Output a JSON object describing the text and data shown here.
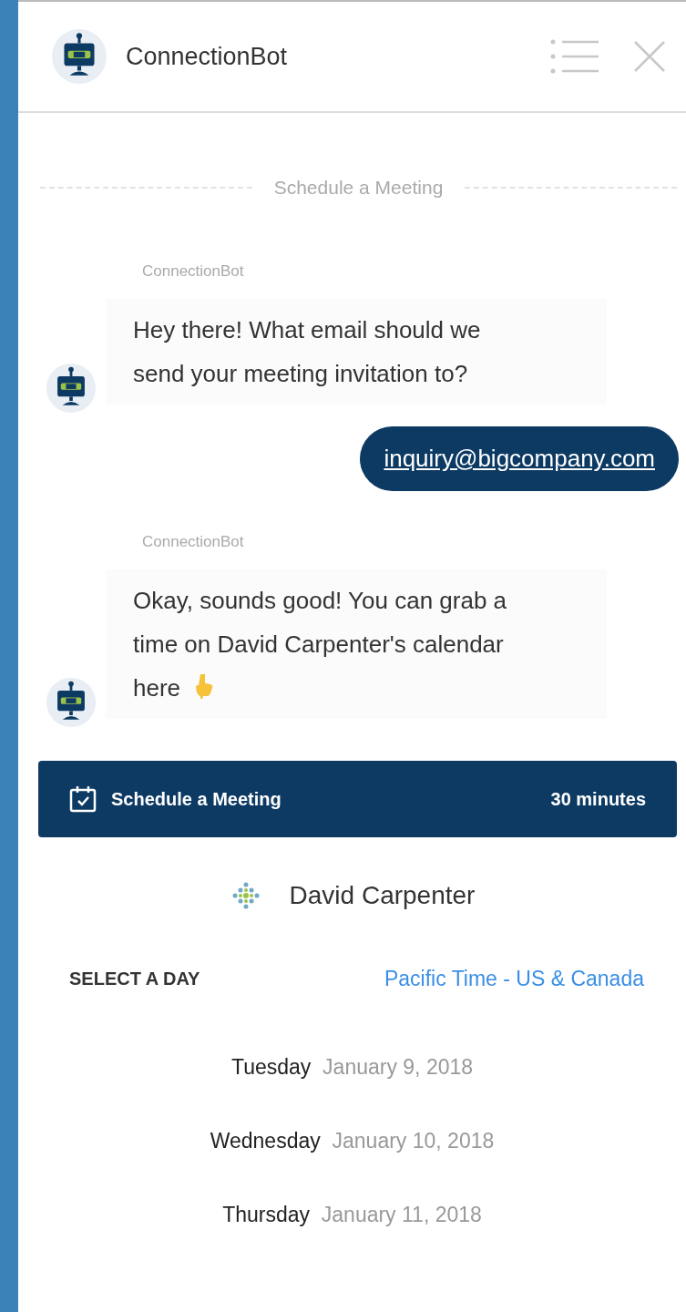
{
  "header": {
    "title": "ConnectionBot"
  },
  "divider_label": "Schedule a Meeting",
  "messages": [
    {
      "kind": "bot",
      "sender": "ConnectionBot",
      "text": "Hey there! What email should we send your meeting invitation to?",
      "pointing_hand": false
    },
    {
      "kind": "user",
      "text": "inquiry@bigcompany.com"
    },
    {
      "kind": "bot",
      "sender": "ConnectionBot",
      "text": "Okay, sounds good! You can grab a time on David Carpenter's calendar here",
      "pointing_hand": true
    }
  ],
  "scheduler": {
    "title": "Schedule a Meeting",
    "duration": "30 minutes",
    "host": "David Carpenter",
    "select_label": "SELECT A DAY",
    "timezone": "Pacific Time - US & Canada",
    "days": [
      {
        "weekday": "Tuesday",
        "date": "January 9, 2018"
      },
      {
        "weekday": "Wednesday",
        "date": "January 10, 2018"
      },
      {
        "weekday": "Thursday",
        "date": "January 11, 2018"
      }
    ]
  }
}
